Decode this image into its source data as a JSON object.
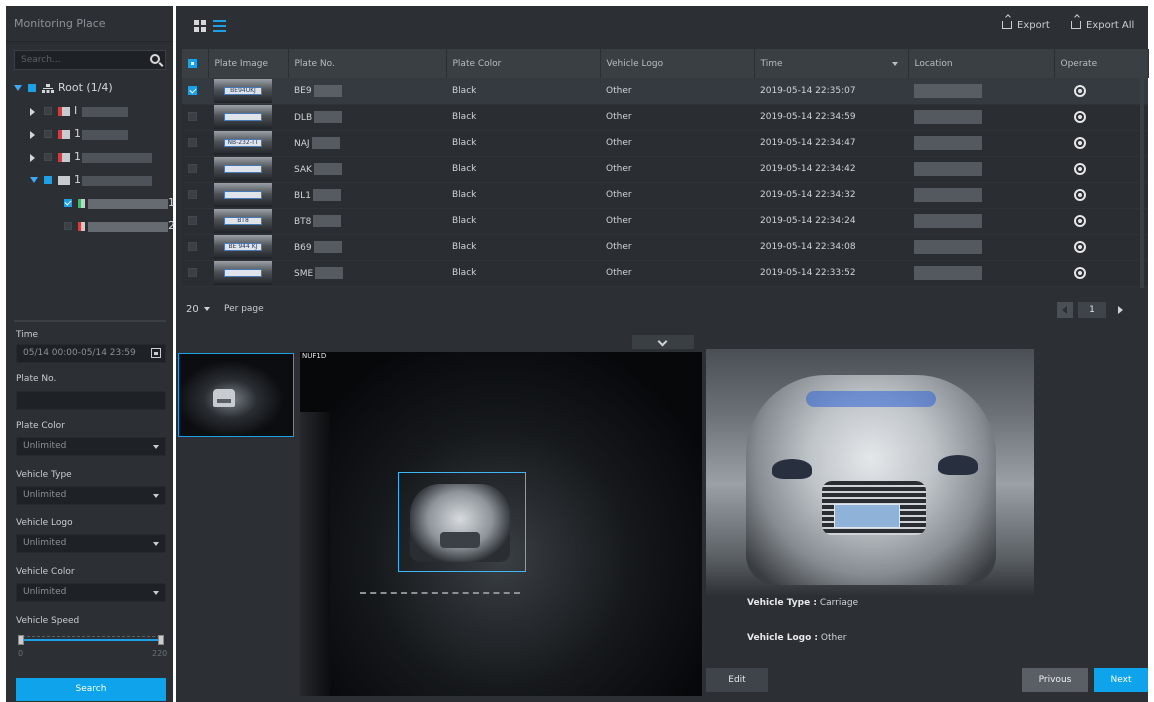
{
  "left_panel": {
    "title": "Monitoring Place",
    "search_placeholder": "Search...",
    "tree": {
      "root_label": "Root (1/4)",
      "children": [
        {
          "label": "I"
        },
        {
          "label": "1"
        },
        {
          "label": "1"
        },
        {
          "label": "1"
        },
        {
          "label": "1"
        },
        {
          "label": "2"
        }
      ]
    },
    "filters": {
      "time_label": "Time",
      "time_value": "05/14 00:00-05/14 23:59",
      "plate_no_label": "Plate No.",
      "plate_no_value": "",
      "plate_color_label": "Plate Color",
      "plate_color_value": "Unlimited",
      "vehicle_type_label": "Vehicle Type",
      "vehicle_type_value": "Unlimited",
      "vehicle_logo_label": "Vehicle Logo",
      "vehicle_logo_value": "Unlimited",
      "vehicle_color_label": "Vehicle Color",
      "vehicle_color_value": "Unlimited",
      "vehicle_speed_label": "Vehicle Speed",
      "speed_min": "0",
      "speed_max": "220"
    },
    "search_button": "Search"
  },
  "toolbar": {
    "export_label": "Export",
    "export_all_label": "Export All"
  },
  "table": {
    "headers": [
      "Plate Image",
      "Plate No.",
      "Plate Color",
      "Vehicle Logo",
      "Time",
      "Location",
      "Operate"
    ],
    "rows": [
      {
        "plate_img_text": "BE94UKJ",
        "plate_no": "BE9",
        "plate_color": "Black",
        "vehicle_logo": "Other",
        "time": "2019-05-14 22:35:07",
        "selected": true
      },
      {
        "plate_img_text": "",
        "plate_no": "DLB",
        "plate_color": "Black",
        "vehicle_logo": "Other",
        "time": "2019-05-14 22:34:59",
        "selected": false
      },
      {
        "plate_img_text": "NB-232-TT",
        "plate_no": "NAJ",
        "plate_color": "Black",
        "vehicle_logo": "Other",
        "time": "2019-05-14 22:34:47",
        "selected": false
      },
      {
        "plate_img_text": "",
        "plate_no": "SAK",
        "plate_color": "Black",
        "vehicle_logo": "Other",
        "time": "2019-05-14 22:34:42",
        "selected": false
      },
      {
        "plate_img_text": "",
        "plate_no": "BL1",
        "plate_color": "Black",
        "vehicle_logo": "Other",
        "time": "2019-05-14 22:34:32",
        "selected": false
      },
      {
        "plate_img_text": "BT8",
        "plate_no": "BT8",
        "plate_color": "Black",
        "vehicle_logo": "Other",
        "time": "2019-05-14 22:34:24",
        "selected": false
      },
      {
        "plate_img_text": "BE 944 KJ",
        "plate_no": "B69",
        "plate_color": "Black",
        "vehicle_logo": "Other",
        "time": "2019-05-14 22:34:08",
        "selected": false
      },
      {
        "plate_img_text": "",
        "plate_no": "SME",
        "plate_color": "Black",
        "vehicle_logo": "Other",
        "time": "2019-05-14 22:33:52",
        "selected": false
      }
    ]
  },
  "pager": {
    "per_page_value": "20",
    "per_page_label": "Per page",
    "current_page": "1"
  },
  "detail": {
    "scene_overlay_text": "NUF1D",
    "vehicle_type_label": "Vehicle Type :",
    "vehicle_type_value": "Carriage",
    "vehicle_logo_label": "Vehicle Logo :",
    "vehicle_logo_value": "Other",
    "edit_label": "Edit",
    "previous_label": "Privous",
    "next_label": "Next"
  },
  "colors": {
    "accent": "#0fa3ec",
    "panel_bg": "#2c3035"
  }
}
